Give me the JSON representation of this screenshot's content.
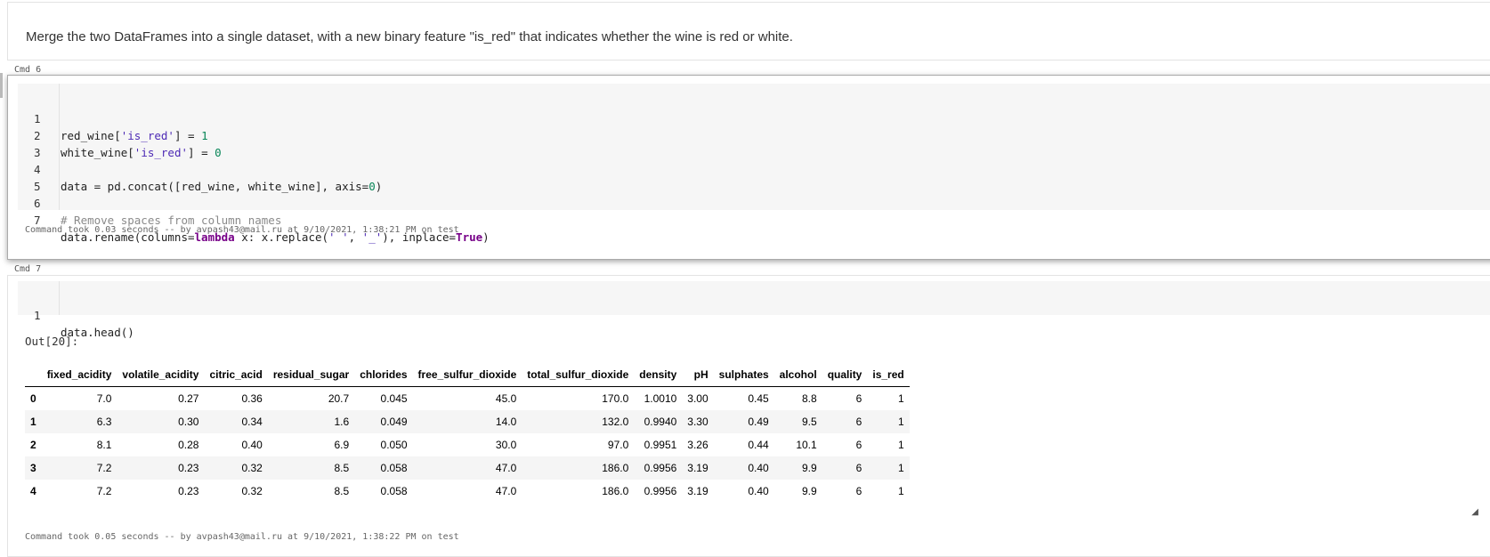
{
  "markdown": {
    "text": "Merge the two DataFrames into a single dataset, with a new binary feature \"is_red\" that indicates whether the wine is red or white."
  },
  "cell6": {
    "label": "Cmd 6",
    "line_numbers": [
      "1",
      "2",
      "3",
      "4",
      "5",
      "6",
      "7"
    ],
    "footer": "Command took 0.03 seconds -- by avpash43@mail.ru at 9/10/2021, 1:38:21 PM on test"
  },
  "cell7": {
    "label": "Cmd 7",
    "line_numbers": [
      "1"
    ],
    "code": "data.head()",
    "out_label": "Out[20]:",
    "footer": "Command took 0.05 seconds -- by avpash43@mail.ru at 9/10/2021, 1:38:22 PM on test"
  },
  "toolbar": {
    "run_icon": "play-icon",
    "expand_icon": "chevron-down-icon",
    "minimize_icon": "minus-icon",
    "close_icon": "close-icon"
  },
  "table": {
    "columns": [
      "",
      "fixed_acidity",
      "volatile_acidity",
      "citric_acid",
      "residual_sugar",
      "chlorides",
      "free_sulfur_dioxide",
      "total_sulfur_dioxide",
      "density",
      "pH",
      "sulphates",
      "alcohol",
      "quality",
      "is_red"
    ],
    "rows": [
      [
        "0",
        "7.0",
        "0.27",
        "0.36",
        "20.7",
        "0.045",
        "45.0",
        "170.0",
        "1.0010",
        "3.00",
        "0.45",
        "8.8",
        "6",
        "1"
      ],
      [
        "1",
        "6.3",
        "0.30",
        "0.34",
        "1.6",
        "0.049",
        "14.0",
        "132.0",
        "0.9940",
        "3.30",
        "0.49",
        "9.5",
        "6",
        "1"
      ],
      [
        "2",
        "8.1",
        "0.28",
        "0.40",
        "6.9",
        "0.050",
        "30.0",
        "97.0",
        "0.9951",
        "3.26",
        "0.44",
        "10.1",
        "6",
        "1"
      ],
      [
        "3",
        "7.2",
        "0.23",
        "0.32",
        "8.5",
        "0.058",
        "47.0",
        "186.0",
        "0.9956",
        "3.19",
        "0.40",
        "9.9",
        "6",
        "1"
      ],
      [
        "4",
        "7.2",
        "0.23",
        "0.32",
        "8.5",
        "0.058",
        "47.0",
        "186.0",
        "0.9956",
        "3.19",
        "0.40",
        "9.9",
        "6",
        "1"
      ]
    ]
  }
}
